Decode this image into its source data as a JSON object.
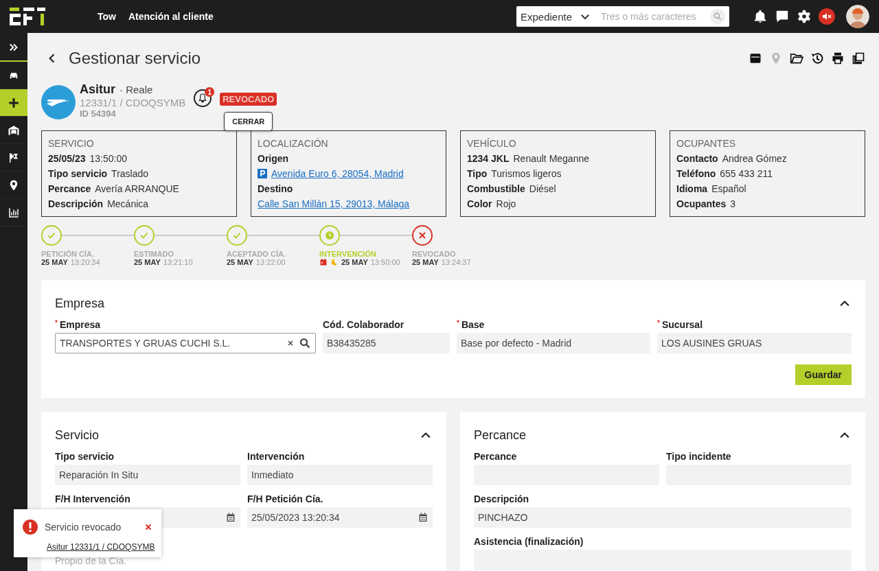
{
  "topbar": {
    "nav": [
      {
        "label": "Tow"
      },
      {
        "label": "Atención al cliente"
      }
    ],
    "search": {
      "scope": "Expediente",
      "placeholder": "Tres o más caracteres"
    }
  },
  "sidebar": {
    "items": [
      {
        "selected": false
      },
      {
        "selected": false
      },
      {
        "selected": true
      },
      {
        "selected": false
      },
      {
        "selected": false
      },
      {
        "selected": false
      },
      {
        "selected": false
      }
    ]
  },
  "page": {
    "title": "Gestionar servicio"
  },
  "toolbar": [
    {
      "disabled": false
    },
    {
      "disabled": true
    },
    {
      "disabled": false
    },
    {
      "disabled": false
    },
    {
      "disabled": false
    },
    {
      "disabled": false
    }
  ],
  "client": {
    "name": "Asitur",
    "separator": "·",
    "insurer": "Reale",
    "reference": "12331/1 / CDOQSYMB",
    "id": "ID 54394",
    "notifications": "1",
    "status": "REVOCADO",
    "status_tooltip": "CERRAR"
  },
  "info_cards": [
    {
      "title": "SERVICIO",
      "rows": [
        {
          "kind": "pair",
          "label": "25/05/23",
          "value": "13:50:00"
        },
        {
          "kind": "pair",
          "label": "Tipo servicio",
          "value": "Traslado"
        },
        {
          "kind": "pair",
          "label": "Percance",
          "value": "Avería ARRANQUE"
        },
        {
          "kind": "pair",
          "label": "Descripción",
          "value": "Mecánica"
        }
      ]
    },
    {
      "title": "LOCALIZACIÓN",
      "rows": [
        {
          "kind": "heading",
          "label": "Origen"
        },
        {
          "kind": "link",
          "value": "Avenida Euro 6, 28054, Madrid",
          "parking": true
        },
        {
          "kind": "heading",
          "label": "Destino"
        },
        {
          "kind": "link",
          "value": "Calle San Millán 15, 29013, Málaga",
          "parking": false
        }
      ]
    },
    {
      "title": "VEHÍCULO",
      "rows": [
        {
          "kind": "pair",
          "label": "1234 JKL",
          "value": "Renault Meganne"
        },
        {
          "kind": "pair",
          "label": "Tipo",
          "value": "Turismos ligeros"
        },
        {
          "kind": "pair",
          "label": "Combustible",
          "value": "Diésel"
        },
        {
          "kind": "pair",
          "label": "Color",
          "value": "Rojo"
        }
      ]
    },
    {
      "title": "OCUPANTES",
      "rows": [
        {
          "kind": "pair",
          "label": "Contacto",
          "value": "Andrea Gómez"
        },
        {
          "kind": "pair",
          "label": "Teléfono",
          "value": "655 433 211"
        },
        {
          "kind": "pair",
          "label": "Idioma",
          "value": "Español"
        },
        {
          "kind": "pair",
          "label": "Ocupantes",
          "value": "3"
        }
      ]
    }
  ],
  "timeline": [
    {
      "label": "PETICIÓN CÍA.",
      "date": "25 MAY",
      "time": "13:20:34",
      "kind": "done",
      "scheduled": false,
      "night": false
    },
    {
      "label": "ESTIMADO",
      "date": "25 MAY",
      "time": "13:21:10",
      "kind": "done",
      "scheduled": false,
      "night": false
    },
    {
      "label": "ACEPTADO CÍA.",
      "date": "25 MAY",
      "time": "13:22:00",
      "kind": "done",
      "scheduled": false,
      "night": false
    },
    {
      "label": "INTERVENCIÓN",
      "date": "25 MAY",
      "time": "13:50:00",
      "kind": "current",
      "scheduled": true,
      "night": true
    },
    {
      "label": "REVOCADO",
      "date": "25 MAY",
      "time": "13:24:37",
      "kind": "revoked",
      "scheduled": false,
      "night": false
    }
  ],
  "empresa_panel": {
    "title": "Empresa",
    "expanded": true,
    "required_mark": "*",
    "fields": [
      {
        "label": "Empresa",
        "required": true,
        "kind": "search",
        "value": "TRANSPORTES Y GRUAS CUCHI S.L."
      },
      {
        "label": "Cód. Colaborador",
        "required": false,
        "kind": "text",
        "value": "B38435285"
      },
      {
        "label": "Base",
        "required": true,
        "kind": "text",
        "value": "Base por defecto - Madrid"
      },
      {
        "label": "Sucursal",
        "required": true,
        "kind": "text",
        "value": "LOS AUSINES GRUAS"
      }
    ],
    "button": "Guardar"
  },
  "servicio_panel": {
    "title": "Servicio",
    "expanded": true,
    "fields": [
      {
        "label": "Tipo servicio",
        "kind": "text",
        "value": "Reparación In Situ"
      },
      {
        "label": "Intervención",
        "kind": "text",
        "value": "Inmediato"
      },
      {
        "label": "F/H Intervención",
        "kind": "date"
      },
      {
        "label": "F/H Petición Cía.",
        "kind": "date",
        "value": "25/05/2023 13:20:34"
      }
    ],
    "note": "Propio de la Cía."
  },
  "percance_panel": {
    "title": "Percance",
    "expanded": true,
    "fields": [
      {
        "label": "Percance",
        "kind": "text"
      },
      {
        "label": "Tipo incidente",
        "kind": "text"
      },
      {
        "label": "Descripción",
        "kind": "wide",
        "value": "PINCHAZO"
      },
      {
        "label": "Asistencia (finalización)",
        "kind": "wide"
      }
    ]
  },
  "toast": {
    "message": "Servicio revocado",
    "link": "Asitur 12331/1 / CDOQSYMB"
  }
}
